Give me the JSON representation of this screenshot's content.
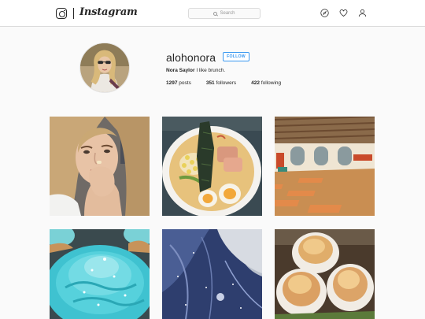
{
  "header": {
    "wordmark": "Instagram",
    "search_placeholder": "Search",
    "icons": [
      "instagram-logo-icon",
      "compass-icon",
      "heart-icon",
      "person-icon"
    ]
  },
  "profile": {
    "username": "alohonora",
    "follow_label": "FOLLOW",
    "full_name": "Nora Saylor",
    "bio": "I like brunch.",
    "stats": {
      "posts_count": "1297",
      "posts_label": "posts",
      "followers_count": "351",
      "followers_label": "followers",
      "following_count": "422",
      "following_label": "following"
    }
  },
  "posts": [
    {
      "subject": "selfie"
    },
    {
      "subject": "ramen"
    },
    {
      "subject": "studio"
    },
    {
      "subject": "cupcake"
    },
    {
      "subject": "marble"
    },
    {
      "subject": "pastries"
    }
  ],
  "colors": {
    "accent": "#3897f0",
    "border": "#dbdbdb",
    "background": "#fafafa",
    "text": "#262626"
  }
}
